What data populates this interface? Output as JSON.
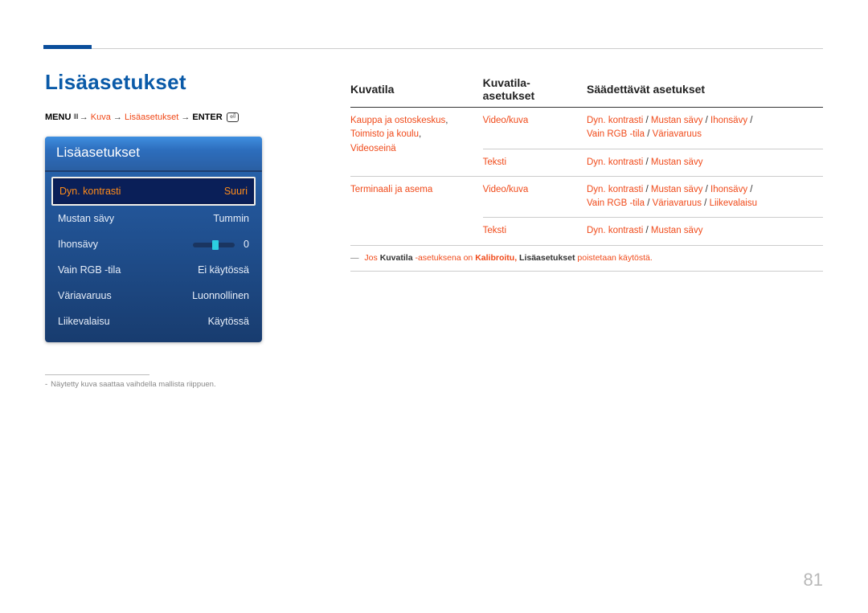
{
  "page_number": "81",
  "page_title": "Lisäasetukset",
  "path": {
    "menu_label": "MENU",
    "items": [
      "Kuva",
      "Lisäasetukset"
    ],
    "enter_label": "ENTER"
  },
  "panel": {
    "title": "Lisäasetukset",
    "rows": [
      {
        "label": "Dyn. kontrasti",
        "value": "Suuri",
        "selected": true
      },
      {
        "label": "Mustan sävy",
        "value": "Tummin"
      },
      {
        "label": "Ihonsävy",
        "value": "0",
        "slider": true
      },
      {
        "label": "Vain RGB -tila",
        "value": "Ei käytössä"
      },
      {
        "label": "Väriavaruus",
        "value": "Luonnollinen"
      },
      {
        "label": "Liikevalaisu",
        "value": "Käytössä"
      }
    ]
  },
  "footnote": "Näytetty kuva saattaa vaihdella mallista riippuen.",
  "table": {
    "headers": [
      "Kuvatila",
      "Kuvatila-asetukset",
      "Säädettävät asetukset"
    ],
    "rows": [
      {
        "c1": "Kauppa ja ostoskeskus, Toimisto ja koulu, Videoseinä",
        "c1_parts": [
          "Kauppa ja ostoskeskus",
          ", ",
          "Toimisto ja koulu",
          ", ",
          "Videoseinä"
        ],
        "subrows": [
          {
            "c2": "Video/kuva",
            "c3_parts": [
              "Dyn. kontrasti",
              " / ",
              "Mustan sävy",
              " / ",
              "Ihonsävy",
              " / ",
              "Vain RGB -tila",
              " / ",
              "Väriavaruus"
            ]
          },
          {
            "c2": "Teksti",
            "c3_parts": [
              "Dyn. kontrasti",
              " / ",
              "Mustan sävy"
            ]
          }
        ]
      },
      {
        "c1": "Terminaali ja asema",
        "subrows": [
          {
            "c2": "Video/kuva",
            "c3_parts": [
              "Dyn. kontrasti",
              " / ",
              "Mustan sävy",
              " / ",
              "Ihonsävy",
              " / ",
              "Vain RGB -tila",
              " / ",
              "Väriavaruus",
              " / ",
              "Liikevalaisu"
            ]
          },
          {
            "c2": "Teksti",
            "c3_parts": [
              "Dyn. kontrasti",
              " / ",
              "Mustan sävy"
            ]
          }
        ]
      }
    ]
  },
  "note": {
    "dash": "―",
    "pre": "Jos ",
    "bold1": "Kuvatila",
    "mid": " -asetuksena on ",
    "k1": "Kalibroitu",
    "sep": ", ",
    "bold2": "Lisäasetukset",
    "post": " poistetaan käytöstä."
  }
}
